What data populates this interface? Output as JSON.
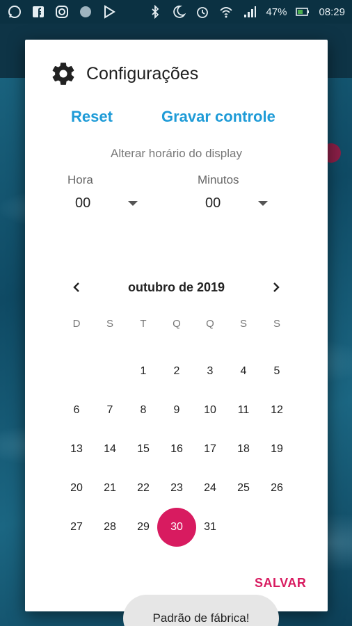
{
  "status_bar": {
    "left_icons": [
      "whatsapp-icon",
      "facebook-icon",
      "instagram-icon",
      "circle-app-icon",
      "play-store-icon"
    ],
    "right_icons": [
      "bluetooth-icon",
      "night-mode-icon",
      "alarm-icon",
      "wifi-icon",
      "signal-icon"
    ],
    "battery_percent": "47%",
    "battery_icon": "battery-charging-icon",
    "time": "08:29"
  },
  "dialog": {
    "icon": "gear-icon",
    "title": "Configurações",
    "actions": {
      "reset": "Reset",
      "record": "Gravar controle"
    },
    "display_label": "Alterar horário do display",
    "hour": {
      "label": "Hora",
      "value": "00"
    },
    "minutes": {
      "label": "Minutos",
      "value": "00"
    },
    "calendar": {
      "month_title": "outubro de 2019",
      "weekdays": [
        "D",
        "S",
        "T",
        "Q",
        "Q",
        "S",
        "S"
      ],
      "weeks": [
        [
          "",
          "",
          "1",
          "2",
          "3",
          "4",
          "5"
        ],
        [
          "6",
          "7",
          "8",
          "9",
          "10",
          "11",
          "12"
        ],
        [
          "13",
          "14",
          "15",
          "16",
          "17",
          "18",
          "19"
        ],
        [
          "20",
          "21",
          "22",
          "23",
          "24",
          "25",
          "26"
        ],
        [
          "27",
          "28",
          "29",
          "30",
          "31",
          "",
          ""
        ]
      ],
      "selected_day": "30"
    },
    "save_label": "SALVAR"
  },
  "toast": {
    "text": "Padrão de fábrica!"
  },
  "colors": {
    "accent": "#d81b60",
    "link": "#1e9bd7"
  }
}
